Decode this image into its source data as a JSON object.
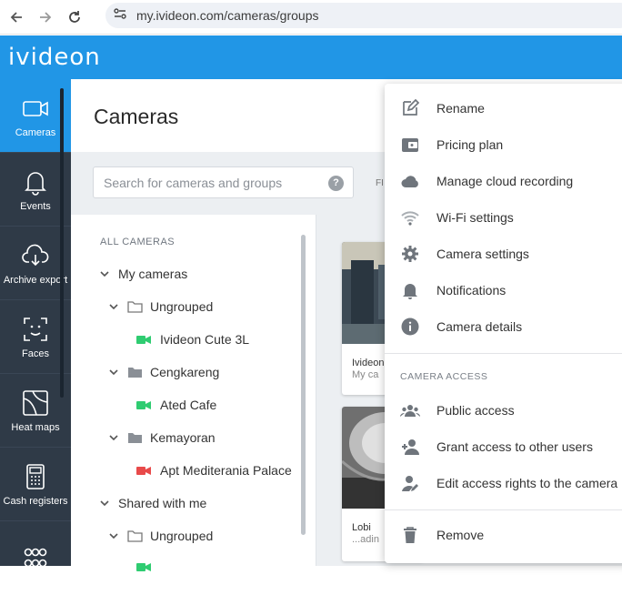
{
  "browser": {
    "back_icon": "arrow-left-icon",
    "forward_icon": "arrow-right-icon",
    "reload_icon": "reload-icon",
    "url": "my.ivideon.com/cameras/groups"
  },
  "app": {
    "logo": "ivideon",
    "brand_color": "#2196e6"
  },
  "sidebar": {
    "items": [
      {
        "label": "Cameras",
        "icon": "camera-icon",
        "active": true
      },
      {
        "label": "Events",
        "icon": "bell-icon"
      },
      {
        "label": "Archive export",
        "icon": "cloud-download-icon"
      },
      {
        "label": "Faces",
        "icon": "face-scan-icon"
      },
      {
        "label": "Heat maps",
        "icon": "heat-map-icon"
      },
      {
        "label": "Cash registers",
        "icon": "cash-register-icon"
      },
      {
        "label": "",
        "icon": "people-icon"
      }
    ]
  },
  "main": {
    "title": "Cameras",
    "search": {
      "placeholder": "Search for cameras and groups",
      "value": ""
    },
    "filter_label": "FI"
  },
  "tree": {
    "header": "ALL CAMERAS",
    "rows": [
      {
        "label": "My cameras"
      },
      {
        "label": "Ungrouped"
      },
      {
        "label": "Ivideon Cute 3L",
        "status": "online"
      },
      {
        "label": "Cengkareng"
      },
      {
        "label": "Ated Cafe",
        "status": "online"
      },
      {
        "label": "Kemayoran"
      },
      {
        "label": "Apt Mediterania Palace",
        "status": "offline"
      },
      {
        "label": "Shared with me"
      },
      {
        "label": "Ungrouped"
      }
    ],
    "colors": {
      "online": "#2fcc71",
      "offline": "#e84a4a"
    }
  },
  "cards": [
    {
      "name": "Ivideon",
      "sub": "My ca"
    },
    {
      "name": "Lobi",
      "sub": "...adin"
    }
  ],
  "menu": {
    "items": [
      {
        "label": "Rename",
        "icon": "edit-icon"
      },
      {
        "label": "Pricing plan",
        "icon": "wallet-icon"
      },
      {
        "label": "Manage cloud recording",
        "icon": "cloud-icon"
      },
      {
        "label": "Wi-Fi settings",
        "icon": "wifi-icon"
      },
      {
        "label": "Camera settings",
        "icon": "gear-icon"
      },
      {
        "label": "Notifications",
        "icon": "bell-icon"
      },
      {
        "label": "Camera details",
        "icon": "info-icon"
      }
    ],
    "section_title": "CAMERA ACCESS",
    "access_items": [
      {
        "label": "Public access",
        "icon": "group-icon"
      },
      {
        "label": "Grant access to other users",
        "icon": "person-add-icon"
      },
      {
        "label": "Edit access rights to the camera",
        "icon": "person-edit-icon"
      }
    ],
    "remove": {
      "label": "Remove",
      "icon": "trash-icon"
    }
  }
}
